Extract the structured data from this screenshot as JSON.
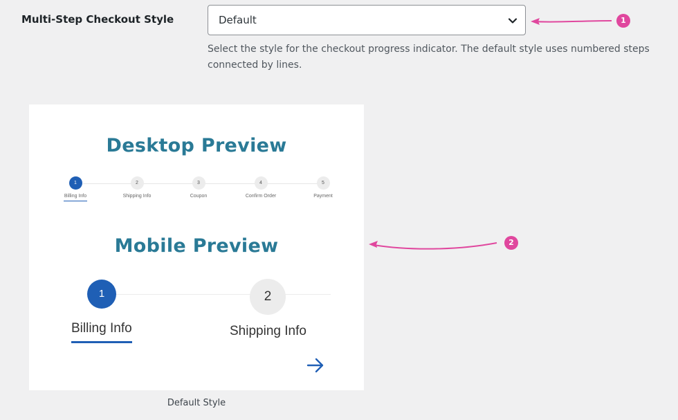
{
  "setting": {
    "label": "Multi-Step Checkout Style",
    "selected_value": "Default",
    "description": "Select the style for the checkout progress indicator. The default style uses numbered steps connected by lines."
  },
  "preview": {
    "desktop_title": "Desktop Preview",
    "mobile_title": "Mobile Preview",
    "desktop_steps": [
      {
        "number": "1",
        "label": "Billing Info"
      },
      {
        "number": "2",
        "label": "Shipping Info"
      },
      {
        "number": "3",
        "label": "Coupon"
      },
      {
        "number": "4",
        "label": "Confirm Order"
      },
      {
        "number": "5",
        "label": "Payment"
      }
    ],
    "mobile_steps": [
      {
        "number": "1",
        "label": "Billing Info"
      },
      {
        "number": "2",
        "label": "Shipping Info"
      }
    ],
    "active_step": 1,
    "next_icon": "arrow-right-icon",
    "caption": "Default Style"
  },
  "annotations": [
    {
      "number": "1"
    },
    {
      "number": "2"
    }
  ],
  "colors": {
    "page_bg": "#f0f0f1",
    "accent_blue": "#1f5fb5",
    "title_teal": "#2a7a96",
    "annotation_pink": "#e0479e"
  }
}
